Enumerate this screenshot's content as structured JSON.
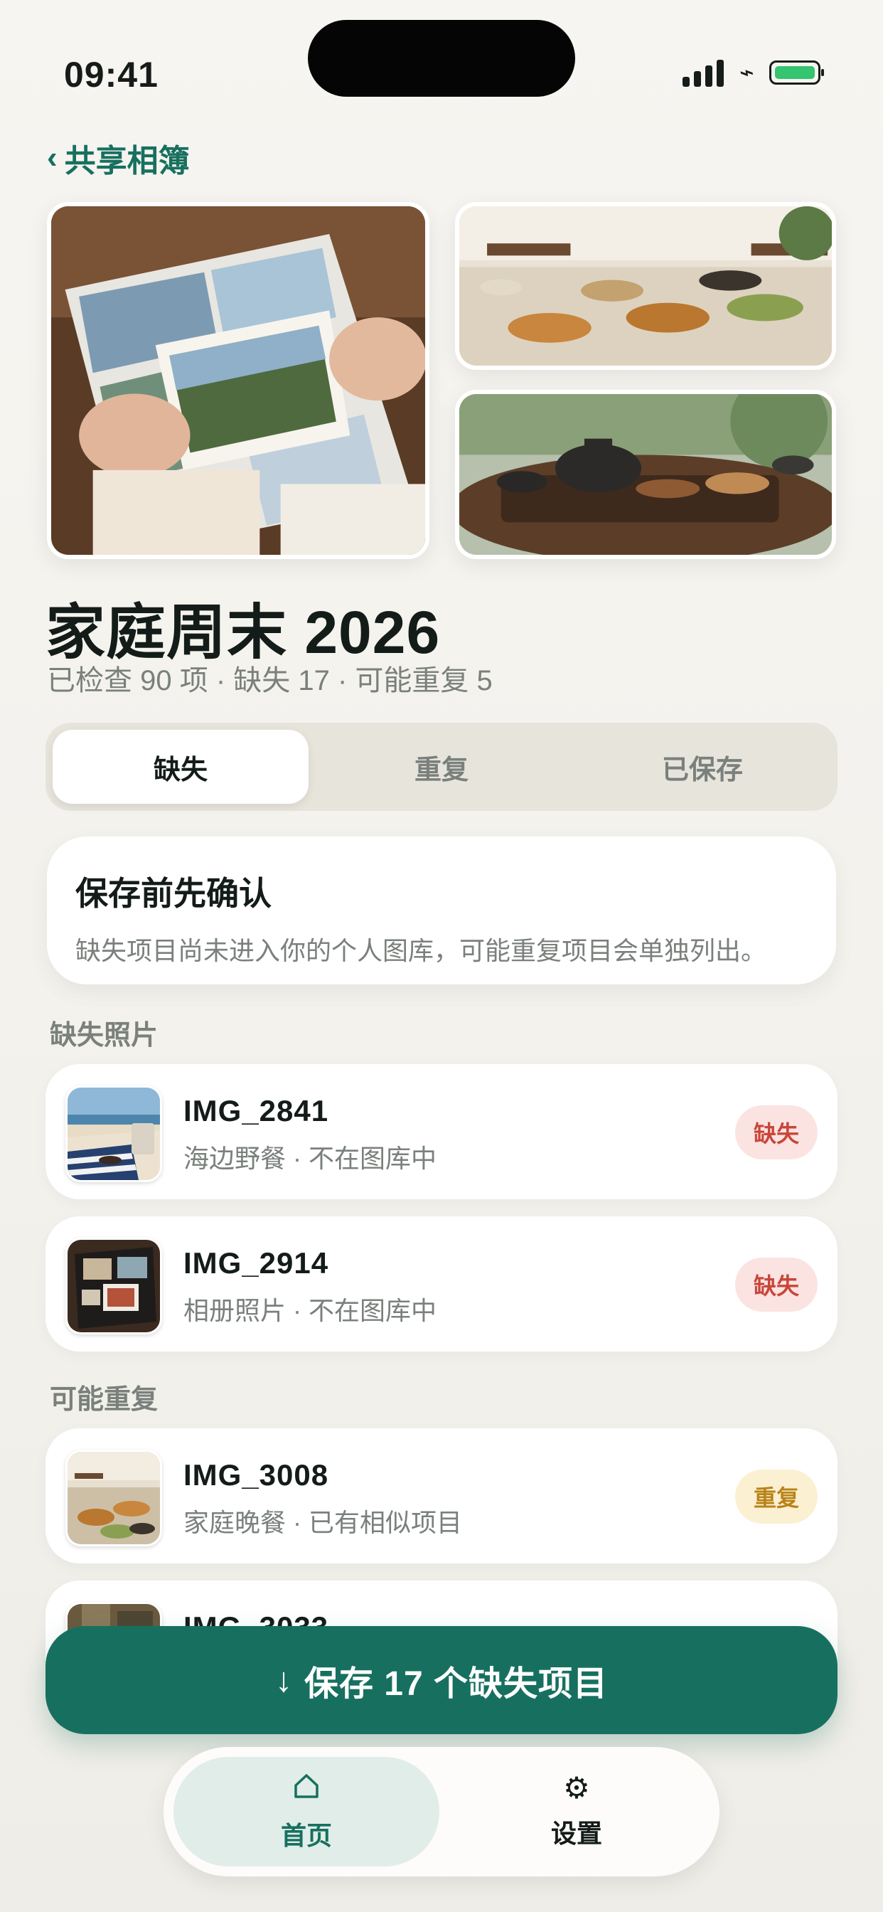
{
  "status_bar": {
    "time": "09:41"
  },
  "nav": {
    "back_label": "共享相簿"
  },
  "album": {
    "title": "家庭周末 2026",
    "summary": "已检查 90 项 · 缺失 17 · 可能重复 5"
  },
  "segments": [
    {
      "label": "缺失",
      "active": true
    },
    {
      "label": "重复",
      "active": false
    },
    {
      "label": "已保存",
      "active": false
    }
  ],
  "notice": {
    "title": "保存前先确认",
    "description": "缺失项目尚未进入你的个人图库，可能重复项目会单独列出。"
  },
  "sections": {
    "missing_label": "缺失照片",
    "duplicate_label": "可能重复"
  },
  "missing_items": [
    {
      "name": "IMG_2841",
      "meta": "海边野餐 · 不在图库中",
      "badge": "缺失"
    },
    {
      "name": "IMG_2914",
      "meta": "相册照片 · 不在图库中",
      "badge": "缺失"
    }
  ],
  "duplicate_items": [
    {
      "name": "IMG_3008",
      "meta": "家庭晚餐 · 已有相似项目",
      "badge": "重复"
    },
    {
      "name": "IMG_3033"
    }
  ],
  "save_button": {
    "label": "保存 17 个缺失项目",
    "icon": "arrow-down-icon"
  },
  "tabbar": [
    {
      "label": "首页",
      "icon": "home-icon",
      "active": true
    },
    {
      "label": "设置",
      "icon": "gear-icon",
      "active": false
    }
  ],
  "colors": {
    "accent": "#17705f",
    "missing_badge_bg": "#fbe3e1",
    "missing_badge_text": "#c8463a",
    "duplicate_badge_bg": "#fcf0d2",
    "duplicate_badge_text": "#b98318"
  }
}
